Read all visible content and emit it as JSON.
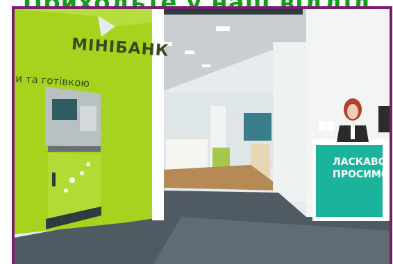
{
  "headline": "Приходьте у наш відділ",
  "photo": {
    "wall_brand": "МІНІБАНК",
    "wall_text": "и та готівкою",
    "desk_sign_line1": "ЛАСКАВО",
    "desk_sign_line2": "ПРОСИМО"
  },
  "colors": {
    "border": "#7b1d6e",
    "headline": "#159a1a",
    "lime_wall": "#a6d41e",
    "teal_sign": "#1bb39b"
  }
}
